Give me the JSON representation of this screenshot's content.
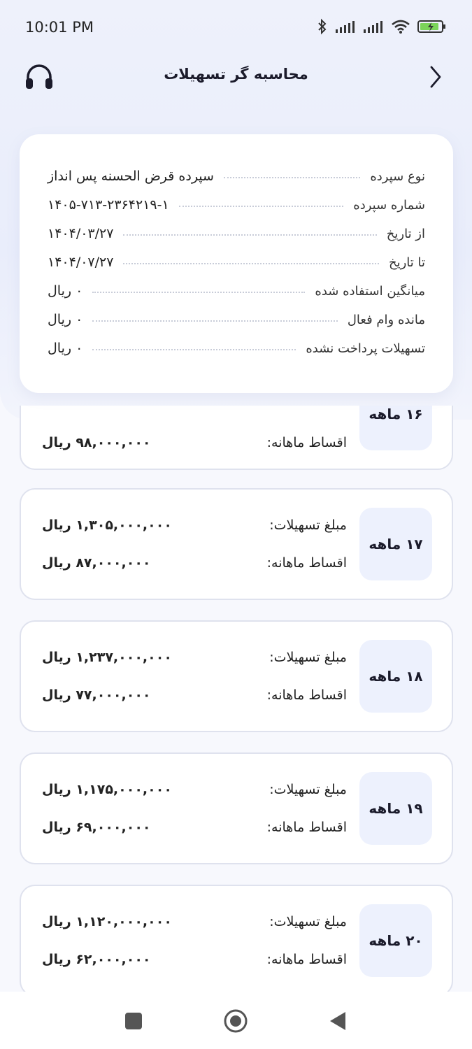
{
  "status_bar": {
    "time": "10:01 PM"
  },
  "header": {
    "title": "محاسبه گر تسهیلات"
  },
  "info": {
    "rows": [
      {
        "label": "نوع سپرده",
        "value": "سپرده قرض الحسنه پس انداز"
      },
      {
        "label": "شماره سپرده",
        "value": "۱۴۰۵-۷۱۳-۲۳۶۴۲۱۹-۱"
      },
      {
        "label": "از تاریخ",
        "value": "۱۴۰۴/۰۳/۲۷"
      },
      {
        "label": "تا تاریخ",
        "value": "۱۴۰۴/۰۷/۲۷"
      },
      {
        "label": "میانگین استفاده شده",
        "value": "۰ ریال"
      },
      {
        "label": "مانده وام فعال",
        "value": "۰ ریال"
      },
      {
        "label": "تسهیلات پرداخت نشده",
        "value": "۰ ریال"
      }
    ]
  },
  "plans": [
    {
      "months": "۱۶ ماهه",
      "installment_label": "اقساط ماهانه:",
      "installment": "۹۸,۰۰۰,۰۰۰ ریال"
    },
    {
      "months": "۱۷ ماهه",
      "amount_label": "مبلغ تسهیلات:",
      "amount": "۱,۳۰۵,۰۰۰,۰۰۰ ریال",
      "installment_label": "اقساط ماهانه:",
      "installment": "۸۷,۰۰۰,۰۰۰ ریال"
    },
    {
      "months": "۱۸ ماهه",
      "amount_label": "مبلغ تسهیلات:",
      "amount": "۱,۲۳۷,۰۰۰,۰۰۰ ریال",
      "installment_label": "اقساط ماهانه:",
      "installment": "۷۷,۰۰۰,۰۰۰ ریال"
    },
    {
      "months": "۱۹ ماهه",
      "amount_label": "مبلغ تسهیلات:",
      "amount": "۱,۱۷۵,۰۰۰,۰۰۰ ریال",
      "installment_label": "اقساط ماهانه:",
      "installment": "۶۹,۰۰۰,۰۰۰ ریال"
    },
    {
      "months": "۲۰ ماهه",
      "amount_label": "مبلغ تسهیلات:",
      "amount": "۱,۱۲۰,۰۰۰,۰۰۰ ریال",
      "installment_label": "اقساط ماهانه:",
      "installment": "۶۲,۰۰۰,۰۰۰ ریال"
    }
  ],
  "icons": {
    "support": "headset-icon",
    "back": "chevron-right-icon",
    "nav_recent": "square-icon",
    "nav_home": "circle-icon",
    "nav_back": "triangle-back-icon"
  },
  "colors": {
    "accent": "#edf1fd",
    "battery": "#7bd35a"
  }
}
